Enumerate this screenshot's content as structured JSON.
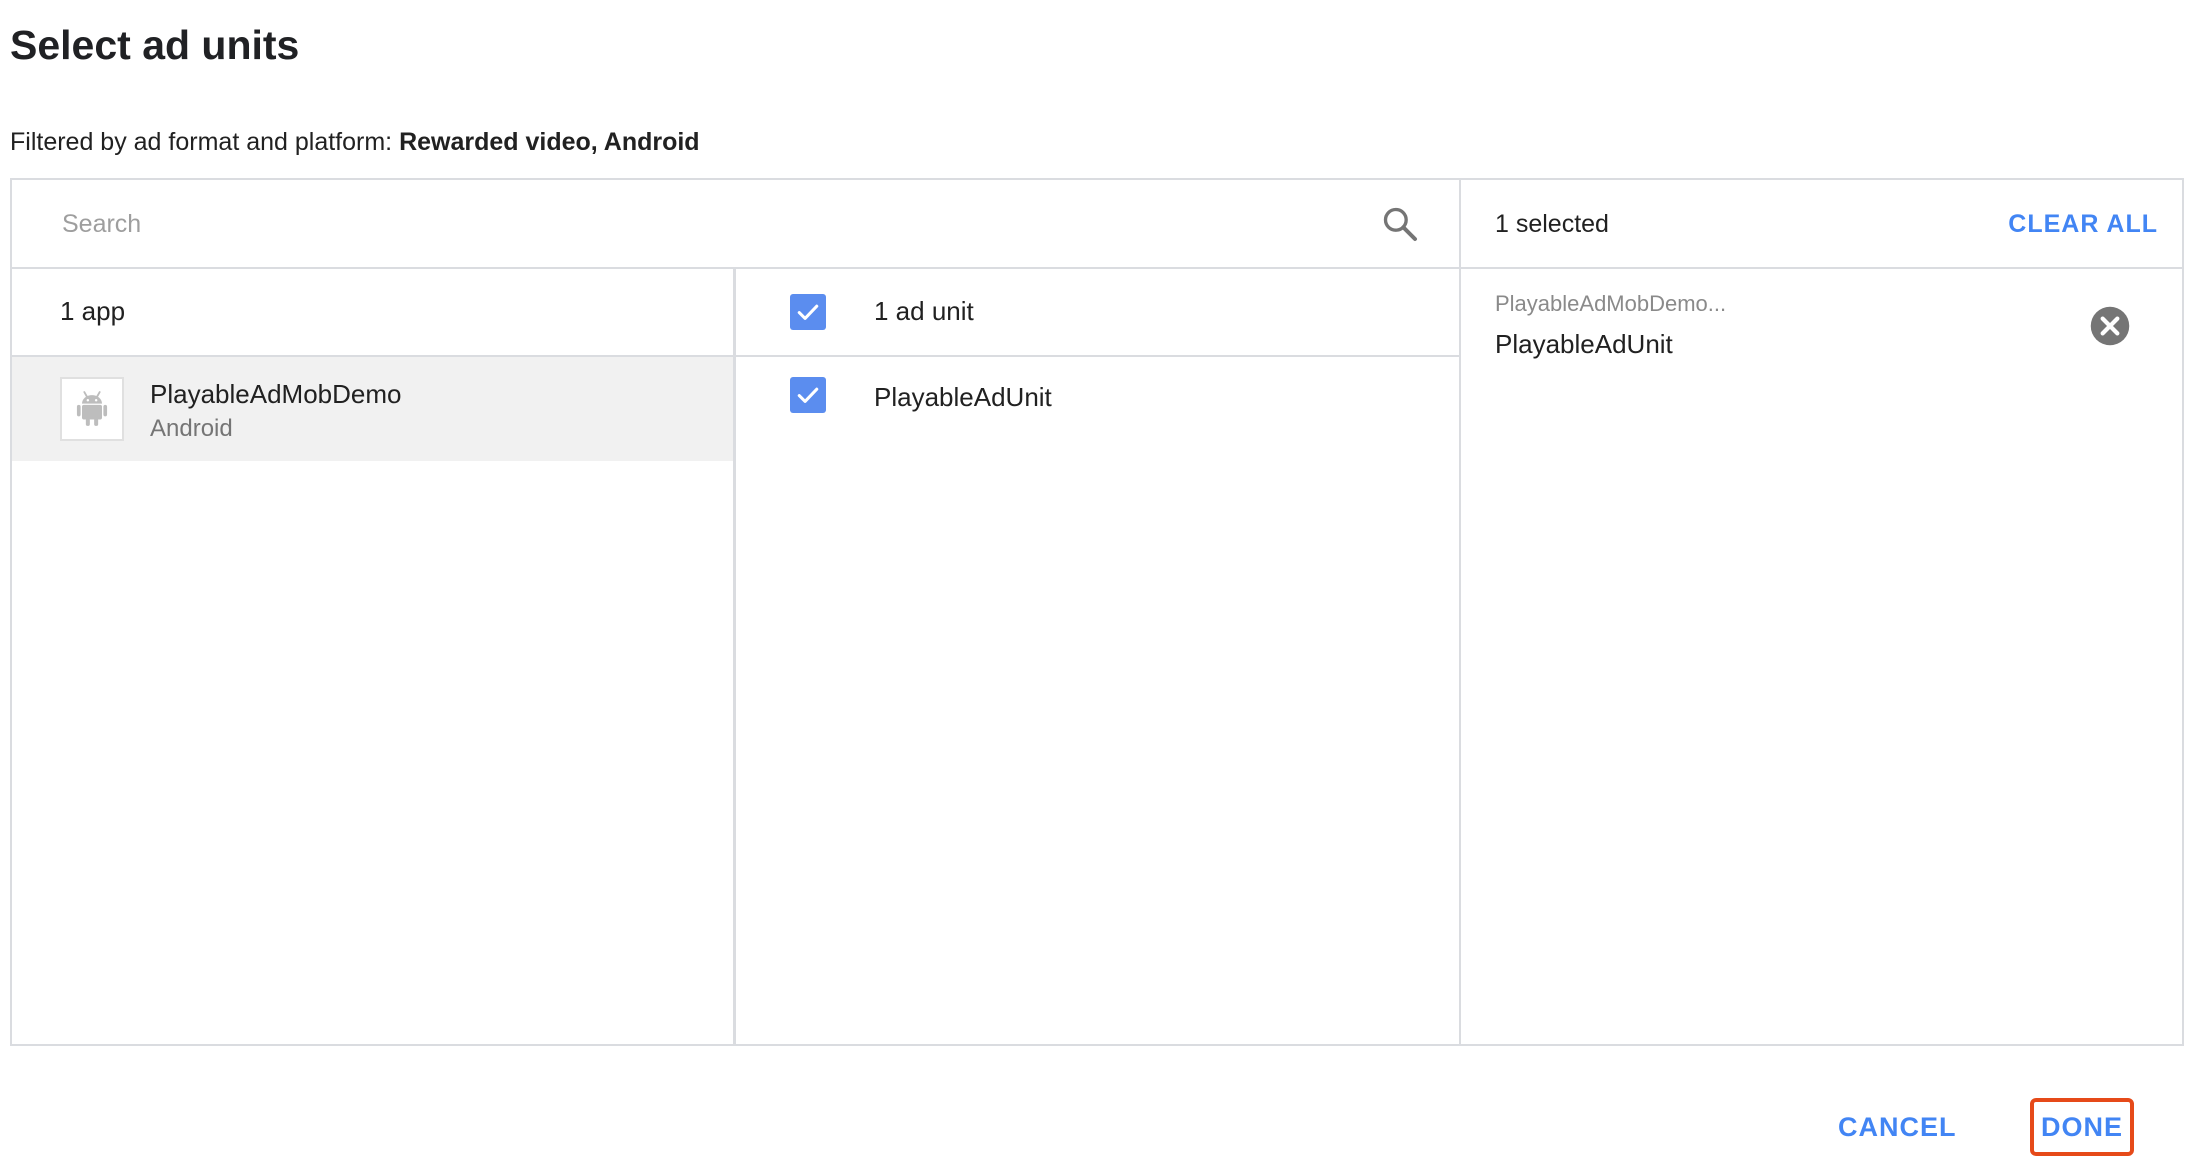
{
  "dialog": {
    "title": "Select ad units",
    "filter_prefix": "Filtered by ad format and platform:",
    "filter_value": "Rewarded video, Android"
  },
  "search": {
    "placeholder": "Search",
    "value": ""
  },
  "apps_column": {
    "header": "1 app",
    "items": [
      {
        "name": "PlayableAdMobDemo",
        "platform": "Android",
        "icon": "android-icon"
      }
    ]
  },
  "ad_units_column": {
    "header": "1 ad unit",
    "header_checked": true,
    "items": [
      {
        "name": "PlayableAdUnit",
        "checked": true
      }
    ]
  },
  "selected_column": {
    "count_label": "1 selected",
    "clear_all_label": "CLEAR ALL",
    "items": [
      {
        "app": "PlayableAdMobDemo...",
        "unit": "PlayableAdUnit"
      }
    ]
  },
  "footer": {
    "cancel_label": "CANCEL",
    "done_label": "DONE"
  },
  "colors": {
    "accent": "#4285f4",
    "checkbox": "#5b8def",
    "highlight_border": "#e64a19",
    "selected_row_bg": "#f1f1f1"
  }
}
